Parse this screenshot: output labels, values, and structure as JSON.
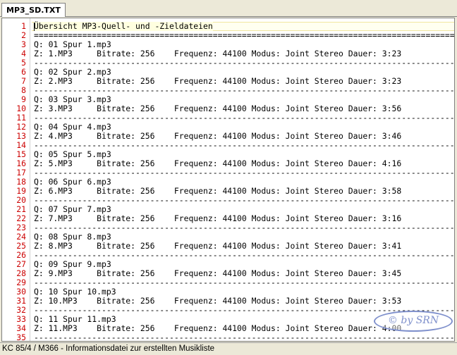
{
  "tab": {
    "label": "MP3_SD.TXT"
  },
  "editor": {
    "lines": [
      {
        "n": "1",
        "t": "Übersicht MP3-Quell- und -Zieldateien"
      },
      {
        "n": "2",
        "t": "=========================================================================================="
      },
      {
        "n": "3",
        "t": "Q: 01 Spur 1.mp3"
      },
      {
        "n": "4",
        "t": "Z: 1.MP3     Bitrate: 256    Frequenz: 44100 Modus: Joint Stereo Dauer: 3:23"
      },
      {
        "n": "5",
        "t": "------------------------------------------------------------------------------------------"
      },
      {
        "n": "6",
        "t": "Q: 02 Spur 2.mp3"
      },
      {
        "n": "7",
        "t": "Z: 2.MP3     Bitrate: 256    Frequenz: 44100 Modus: Joint Stereo Dauer: 3:23"
      },
      {
        "n": "8",
        "t": "------------------------------------------------------------------------------------------"
      },
      {
        "n": "9",
        "t": "Q: 03 Spur 3.mp3"
      },
      {
        "n": "10",
        "t": "Z: 3.MP3     Bitrate: 256    Frequenz: 44100 Modus: Joint Stereo Dauer: 3:56"
      },
      {
        "n": "11",
        "t": "------------------------------------------------------------------------------------------"
      },
      {
        "n": "12",
        "t": "Q: 04 Spur 4.mp3"
      },
      {
        "n": "13",
        "t": "Z: 4.MP3     Bitrate: 256    Frequenz: 44100 Modus: Joint Stereo Dauer: 3:46"
      },
      {
        "n": "14",
        "t": "------------------------------------------------------------------------------------------"
      },
      {
        "n": "15",
        "t": "Q: 05 Spur 5.mp3"
      },
      {
        "n": "16",
        "t": "Z: 5.MP3     Bitrate: 256    Frequenz: 44100 Modus: Joint Stereo Dauer: 4:16"
      },
      {
        "n": "17",
        "t": "------------------------------------------------------------------------------------------"
      },
      {
        "n": "18",
        "t": "Q: 06 Spur 6.mp3"
      },
      {
        "n": "19",
        "t": "Z: 6.MP3     Bitrate: 256    Frequenz: 44100 Modus: Joint Stereo Dauer: 3:58"
      },
      {
        "n": "20",
        "t": "------------------------------------------------------------------------------------------"
      },
      {
        "n": "21",
        "t": "Q: 07 Spur 7.mp3"
      },
      {
        "n": "22",
        "t": "Z: 7.MP3     Bitrate: 256    Frequenz: 44100 Modus: Joint Stereo Dauer: 3:16"
      },
      {
        "n": "23",
        "t": "------------------------------------------------------------------------------------------"
      },
      {
        "n": "24",
        "t": "Q: 08 Spur 8.mp3"
      },
      {
        "n": "25",
        "t": "Z: 8.MP3     Bitrate: 256    Frequenz: 44100 Modus: Joint Stereo Dauer: 3:41"
      },
      {
        "n": "26",
        "t": "------------------------------------------------------------------------------------------"
      },
      {
        "n": "27",
        "t": "Q: 09 Spur 9.mp3"
      },
      {
        "n": "28",
        "t": "Z: 9.MP3     Bitrate: 256    Frequenz: 44100 Modus: Joint Stereo Dauer: 3:45"
      },
      {
        "n": "29",
        "t": "------------------------------------------------------------------------------------------"
      },
      {
        "n": "30",
        "t": "Q: 10 Spur 10.mp3"
      },
      {
        "n": "31",
        "t": "Z: 10.MP3    Bitrate: 256    Frequenz: 44100 Modus: Joint Stereo Dauer: 3:53"
      },
      {
        "n": "32",
        "t": "------------------------------------------------------------------------------------------"
      },
      {
        "n": "33",
        "t": "Q: 11 Spur 11.mp3"
      },
      {
        "n": "34",
        "t": "Z: 11.MP3    Bitrate: 256    Frequenz: 44100 Modus: Joint Stereo Dauer: 4:00"
      },
      {
        "n": "35",
        "t": "------------------------------------------------------------------------------------------"
      }
    ]
  },
  "watermark": {
    "text": "© by SRN"
  },
  "status": {
    "text": "KC 85/4 / M366 - Informationsdatei zur erstellten Musikliste"
  }
}
